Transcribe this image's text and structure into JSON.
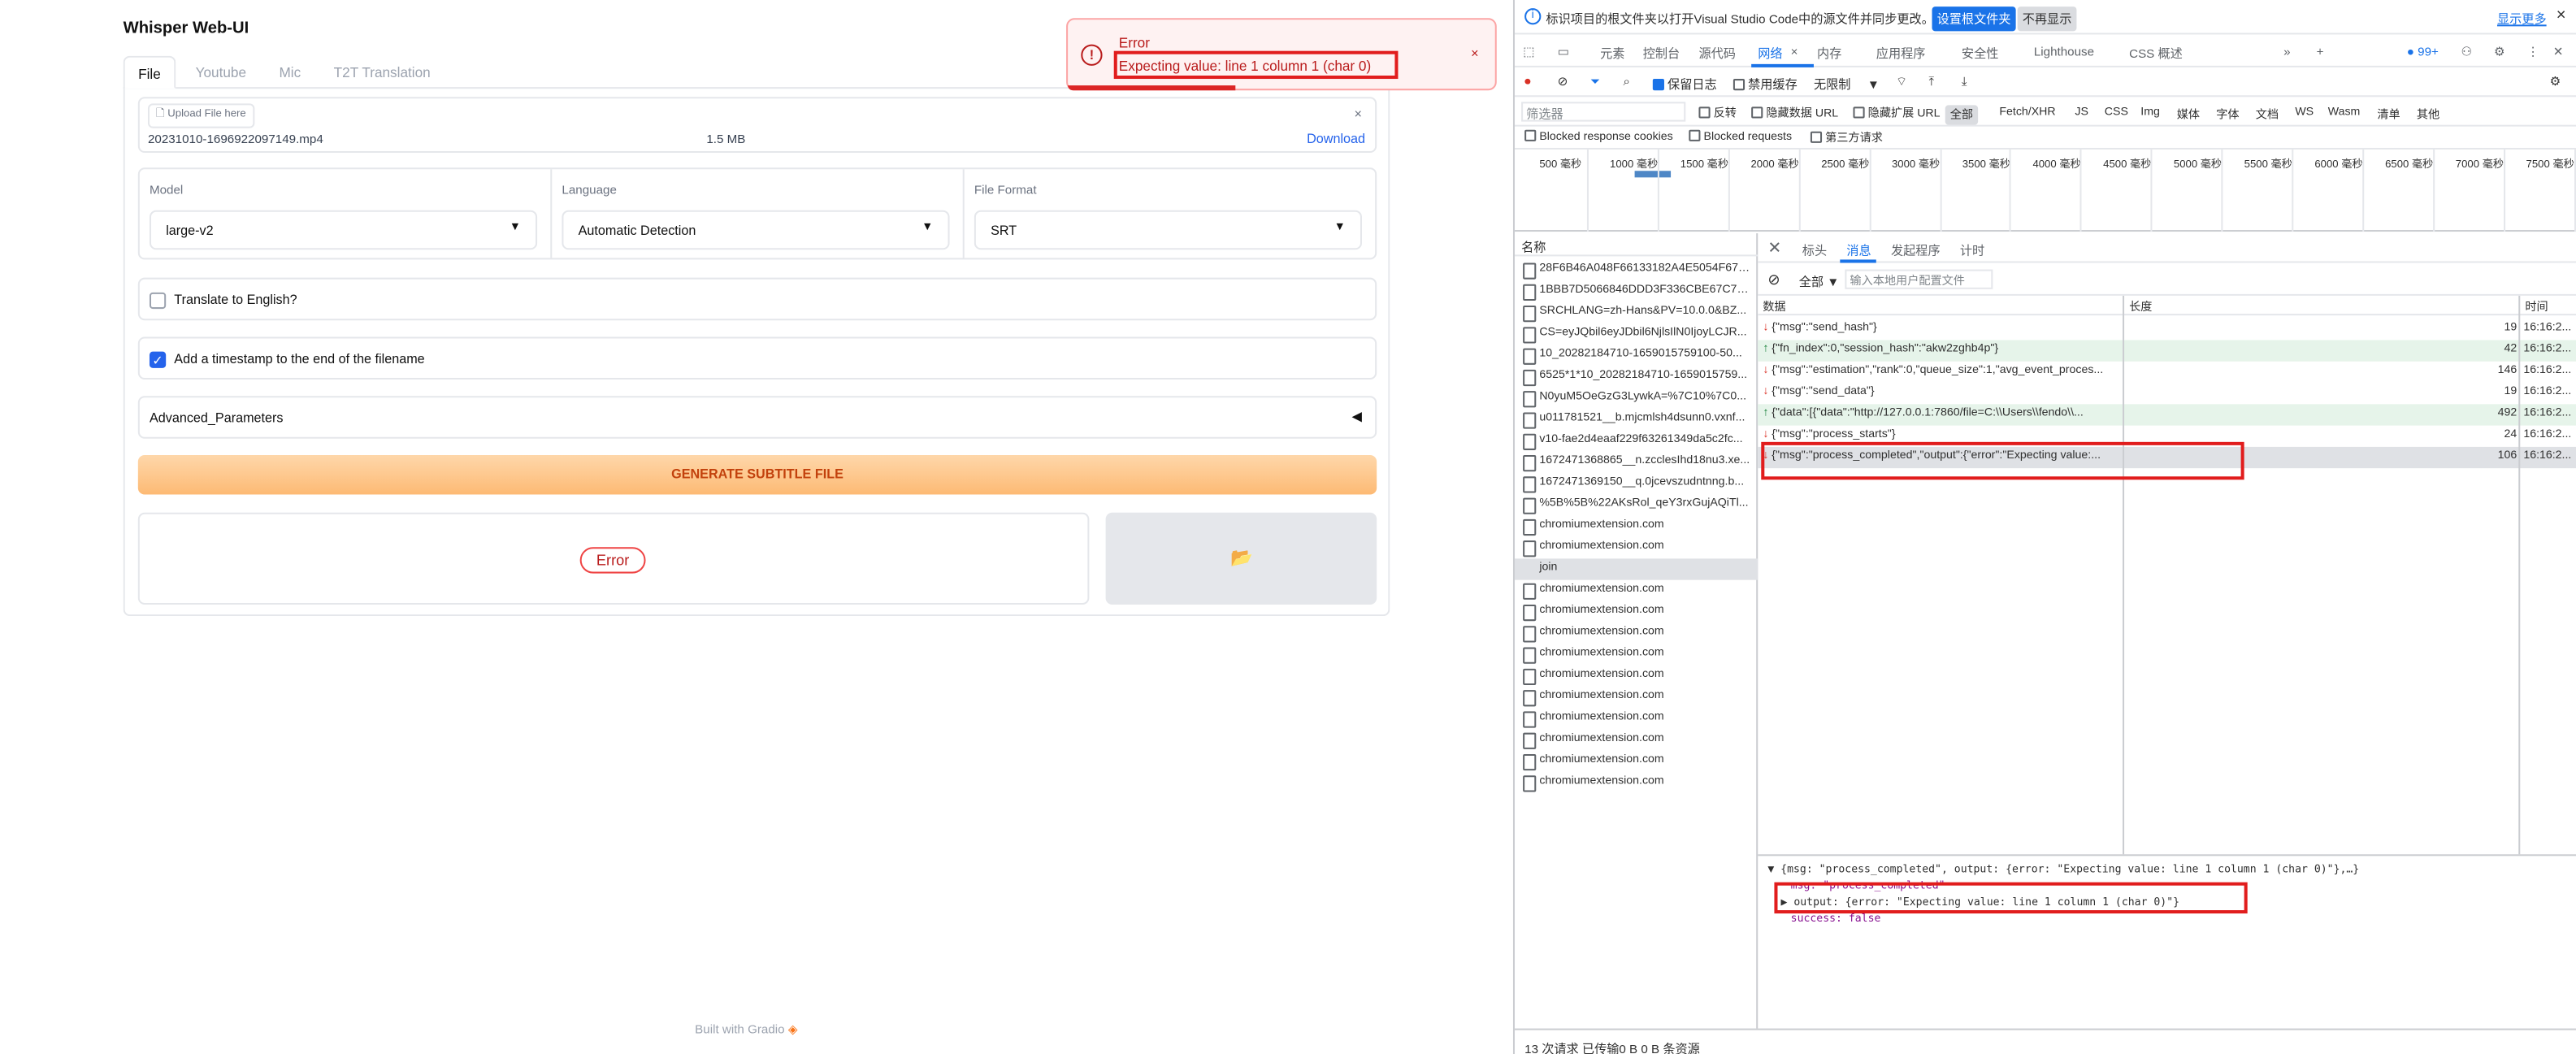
{
  "app": {
    "title": "Whisper Web-UI",
    "tabs": [
      "File",
      "Youtube",
      "Mic",
      "T2T Translation"
    ],
    "upload": {
      "label": "Upload File here",
      "file_name": "20231010-1696922097149.mp4",
      "file_size": "1.5 MB",
      "download": "Download",
      "close": "×"
    },
    "model": {
      "label": "Model",
      "value": "large-v2"
    },
    "language": {
      "label": "Language",
      "value": "Automatic Detection"
    },
    "format": {
      "label": "File Format",
      "value": "SRT"
    },
    "translate": {
      "label": "Translate to English?",
      "checked": false
    },
    "timestamp": {
      "label": "Add a timestamp to the end of the filename",
      "checked": true,
      "check": "✓"
    },
    "advanced": {
      "label": "Advanced_Parameters",
      "tri": "◀"
    },
    "generate": "GENERATE SUBTITLE FILE",
    "error_pill": "Error",
    "folder_icon": "📂",
    "footer": "Built with Gradio"
  },
  "toast": {
    "icon": "!",
    "title": "Error",
    "message": "Expecting value: line 1 column 1 (char 0)",
    "close": "×"
  },
  "devtools": {
    "info_text": "标识项目的根文件夹以打开Visual Studio Code中的源文件并同步更改。",
    "info_btn1": "设置根文件夹",
    "info_btn2": "不再显示",
    "info_link": "显示更多",
    "info_close": "×",
    "info_icon": "i",
    "tabs": [
      "元素",
      "控制台",
      "源代码",
      "网络",
      "内存",
      "应用程序",
      "安全性",
      "Lighthouse",
      "CSS 概述"
    ],
    "tab_close": "×",
    "badge": "99+",
    "toolbar": {
      "preserve_log": "保留日志",
      "disable_cache": "禁用缓存",
      "throttle": "无限制"
    },
    "filter_placeholder": "筛选器",
    "filter_opts": [
      "反转",
      "隐藏数据 URL",
      "隐藏扩展 URL"
    ],
    "types": [
      "全部",
      "Fetch/XHR",
      "JS",
      "CSS",
      "Img",
      "媒体",
      "字体",
      "文档",
      "WS",
      "Wasm",
      "清单",
      "其他"
    ],
    "filter_row2": [
      "Blocked response cookies",
      "Blocked requests",
      "第三方请求"
    ],
    "timeline_ticks": [
      "500 毫秒",
      "1000 毫秒",
      "1500 毫秒",
      "2000 毫秒",
      "2500 毫秒",
      "3000 毫秒",
      "3500 毫秒",
      "4000 毫秒",
      "4500 毫秒",
      "5000 毫秒",
      "5500 毫秒",
      "6000 毫秒",
      "6500 毫秒",
      "7000 毫秒",
      "7500 毫秒"
    ],
    "list_header": "名称",
    "requests": [
      "28F6B46A048F66133182A4E5054F672...",
      "1BBB7D5066846DDD3F336CBE67C76...",
      "SRCHLANG=zh-Hans&PV=10.0.0&BZ...",
      "CS=eyJQbil6eyJDbil6NjlsIlN0IjoyLCJR...",
      "10_20282184710-1659015759100-50...",
      "6525*1*10_20282184710-1659015759...",
      "N0yuM5OeGzG3LywkA=%7C10%7C0...",
      "u011781521__b.mjcmlsh4dsunn0.vxnf...",
      "v10-fae2d4eaaf229f63261349da5c2fc...",
      "1672471368865__n.zcclesIhd18nu3.xe...",
      "1672471369150__q.0jcevszudntnng.b...",
      "%5B%5B%22AKsRol_qeY3rxGujAQiTl...",
      "chromiumextension.com",
      "chromiumextension.com",
      "join",
      "chromiumextension.com",
      "chromiumextension.com",
      "chromiumextension.com",
      "chromiumextension.com",
      "chromiumextension.com",
      "chromiumextension.com",
      "chromiumextension.com",
      "chromiumextension.com",
      "chromiumextension.com",
      "chromiumextension.com"
    ],
    "msg_tabs": [
      "标头",
      "消息",
      "发起程序",
      "计时"
    ],
    "msg_filter_label": "全部",
    "msg_filter_placeholder": "输入本地用户配置文件",
    "msg_cols": [
      "数据",
      "长度",
      "时间"
    ],
    "messages": [
      {
        "arrow": "↓",
        "data": "{\"msg\":\"send_hash\"}",
        "len": "19",
        "time": "16:16:2...",
        "dir": "down"
      },
      {
        "arrow": "↑",
        "data": "{\"fn_index\":0,\"session_hash\":\"akw2zghb4p\"}",
        "len": "42",
        "time": "16:16:2...",
        "dir": "up"
      },
      {
        "arrow": "↓",
        "data": "{\"msg\":\"estimation\",\"rank\":0,\"queue_size\":1,\"avg_event_proces...",
        "len": "146",
        "time": "16:16:2...",
        "dir": "down"
      },
      {
        "arrow": "↓",
        "data": "{\"msg\":\"send_data\"}",
        "len": "19",
        "time": "16:16:2...",
        "dir": "down"
      },
      {
        "arrow": "↑",
        "data": "{\"data\":[{\"data\":\"http://127.0.0.1:7860/file=C:\\\\Users\\\\fendo\\\\...",
        "len": "492",
        "time": "16:16:2...",
        "dir": "up"
      },
      {
        "arrow": "↓",
        "data": "{\"msg\":\"process_starts\"}",
        "len": "24",
        "time": "16:16:2...",
        "dir": "down"
      },
      {
        "arrow": "↓",
        "data": "{\"msg\":\"process_completed\",\"output\":{\"error\":\"Expecting value:...",
        "len": "106",
        "time": "16:16:2...",
        "dir": "down"
      }
    ],
    "detail": {
      "summary": "▼ {msg: \"process_completed\", output: {error: \"Expecting value: line 1 column 1 (char 0)\"},…}",
      "msg_line": "msg: \"process_completed\"",
      "output_line": "▶ output: {error: \"Expecting value: line 1 column 1 (char 0)\"}",
      "success_line": "success: false"
    },
    "status": "13 次请求  已传输0 B  0 B 条资源"
  }
}
